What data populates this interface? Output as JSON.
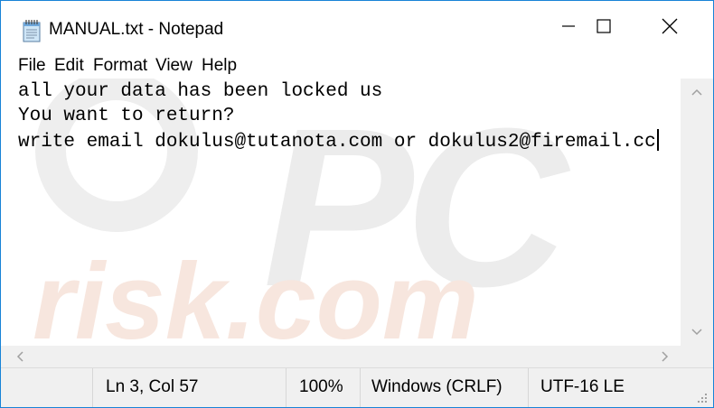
{
  "window": {
    "title": "MANUAL.txt - Notepad"
  },
  "menu": {
    "items": [
      "File",
      "Edit",
      "Format",
      "View",
      "Help"
    ]
  },
  "editor": {
    "lines": [
      "all your data has been locked us",
      "You want to return?",
      "write email dokulus@tutanota.com or dokulus2@firemail.cc"
    ]
  },
  "watermark": {
    "top": "PC",
    "bottom": "risk.com"
  },
  "statusbar": {
    "position": "Ln 3, Col 57",
    "zoom": "100%",
    "line_ending": "Windows (CRLF)",
    "encoding": "UTF-16 LE"
  },
  "icons": {
    "app": "notepad-icon",
    "minimize": "minimize-icon",
    "maximize": "maximize-icon",
    "close": "close-icon",
    "scroll_up": "chevron-up-icon",
    "scroll_down": "chevron-down-icon",
    "scroll_left": "chevron-left-icon",
    "scroll_right": "chevron-right-icon",
    "resize_grip": "resize-grip-icon"
  },
  "colors": {
    "window_border": "#1883d7",
    "chrome": "#f0f0f0"
  }
}
